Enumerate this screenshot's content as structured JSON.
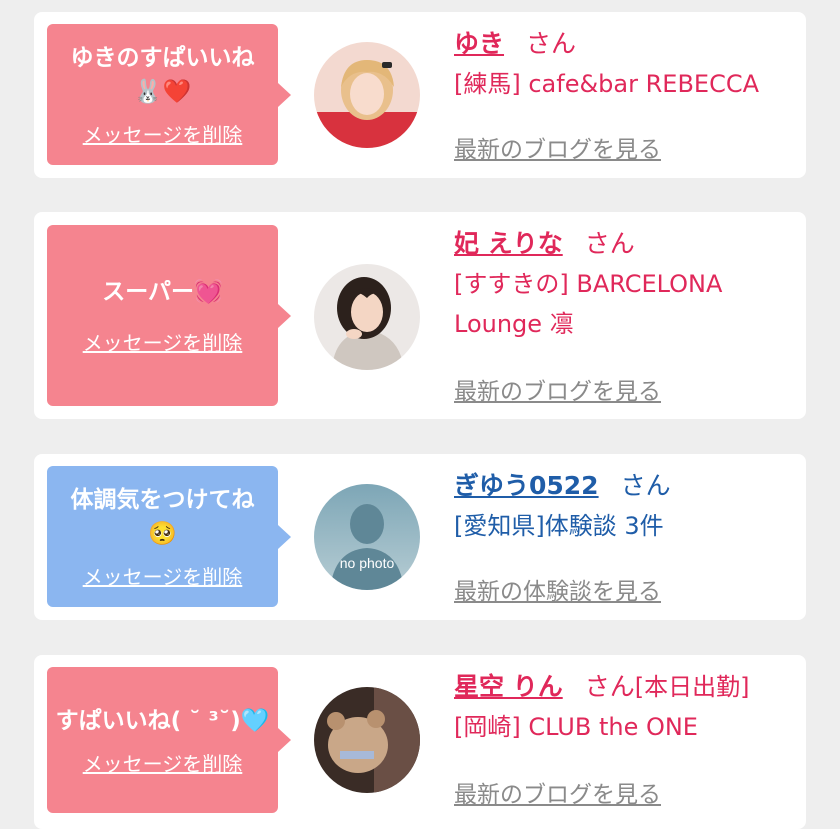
{
  "colors": {
    "background": "#eeeeee",
    "card": "#ffffff",
    "bubble_pink": "#f5848f",
    "bubble_blue": "#8bb6f0",
    "name_pink": "#e0285a",
    "name_blue": "#1f5da8",
    "link_gray": "#8a8a8a"
  },
  "items": [
    {
      "message": "ゆきのすぱいいね",
      "message_emoji": "🐰❤️",
      "delete_label": "メッセージを削除",
      "name": "ゆき",
      "suffix": "さん",
      "shop": "[練馬] cafe&bar REBECCA",
      "link": "最新のブログを見る"
    },
    {
      "message": "スーパー💓",
      "delete_label": "メッセージを削除",
      "name": "妃 えりな",
      "suffix": "さん",
      "shop": "[すすきの] BARCELONA Lounge 凛",
      "link": "最新のブログを見る"
    },
    {
      "message": "体調気をつけてね",
      "message_emoji": "🥺",
      "delete_label": "メッセージを削除",
      "name": "ぎゆう0522",
      "suffix": "さん",
      "shop": "[愛知県]体験談 3件",
      "avatar_text": "no photo",
      "link": "最新の体験談を見る"
    },
    {
      "message": "すぱいいね( ˘ ³˘)🩵",
      "delete_label": "メッセージを削除",
      "name": "星空 りん",
      "suffix": "さん",
      "status": "[本日出勤]",
      "shop": "[岡崎] CLUB the ONE",
      "link": "最新のブログを見る"
    }
  ]
}
